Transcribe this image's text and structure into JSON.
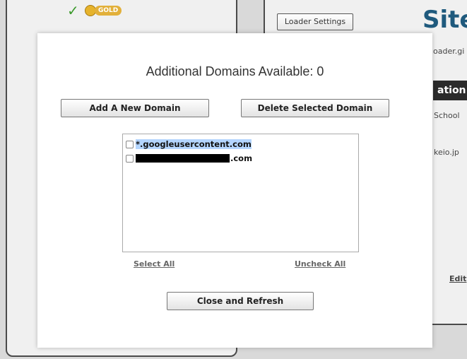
{
  "background": {
    "gold_badge": "GOLD",
    "loader_settings_button": "Loader Settings",
    "site_logo_text": "Site",
    "loader_url_fragment": "oader.gi",
    "section_header_fragment": "ation",
    "school_text_fragment": "School",
    "keio_text_fragment": "keio.jp",
    "edit_link_fragment": "Edit",
    "colors": {
      "check": "#3c9a2c",
      "gold": "#e2b03a",
      "logo": "#1f5a7d"
    }
  },
  "modal": {
    "title": "Additional Domains Available: 0",
    "add_button": "Add A New Domain",
    "delete_button": "Delete Selected Domain",
    "domains": [
      {
        "label": "*.googleusercontent.com",
        "checked": false,
        "selected": true
      },
      {
        "label": ".com",
        "checked": false,
        "redacted_prefix": true
      }
    ],
    "select_all_link": "Select All",
    "uncheck_all_link": "Uncheck All",
    "close_button": "Close and Refresh",
    "colors": {
      "selection_highlight": "#b4d5fe"
    }
  }
}
